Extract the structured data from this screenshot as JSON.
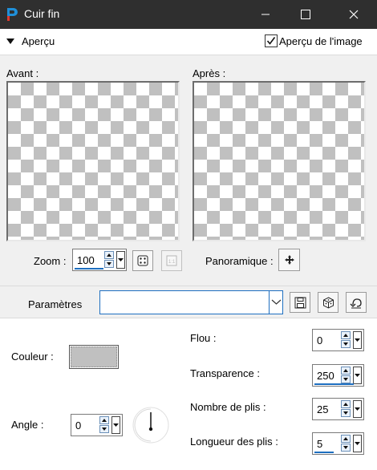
{
  "window": {
    "title": "Cuir fin",
    "minimize_icon": "minimize-icon",
    "maximize_icon": "maximize-icon",
    "close_icon": "close-icon"
  },
  "apercu": {
    "label": "Aperçu",
    "image_preview_label": "Aperçu de l'image",
    "image_preview_checked": true
  },
  "preview": {
    "before_label": "Avant :",
    "after_label": "Après :",
    "zoom_label": "Zoom :",
    "zoom_value": "100",
    "pan_label": "Panoramique :"
  },
  "params": {
    "label": "Paramètres",
    "preset_value": ""
  },
  "settings": {
    "color_label": "Couleur :",
    "color_value": "#c0c0c0",
    "angle_label": "Angle :",
    "angle_value": "0",
    "blur_label": "Flou :",
    "blur_value": "0",
    "transparency_label": "Transparence :",
    "transparency_value": "250",
    "folds_label": "Nombre de plis :",
    "folds_value": "25",
    "fold_length_label": "Longueur des plis :",
    "fold_length_value": "5"
  },
  "colors": {
    "titlebar": "#2f2f2f",
    "accent": "#1e6fc0",
    "app_icon_red": "#e03a2f",
    "app_icon_blue": "#1f8fd8"
  }
}
